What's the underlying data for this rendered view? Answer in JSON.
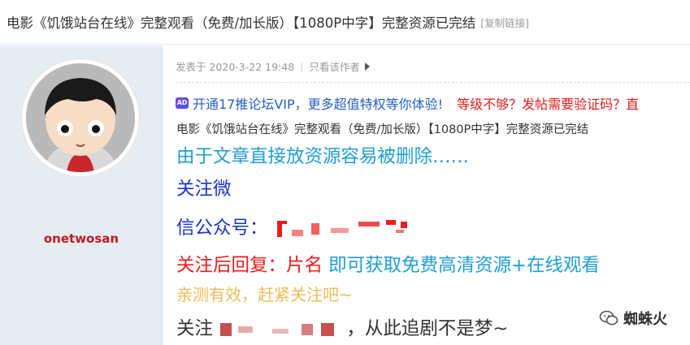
{
  "header": {
    "thread_title": "电影《饥饿站台在线》完整观看（免费/加长版）【1080P中字】完整资源已完结",
    "copy_link_label": "[复制链接]"
  },
  "sidebar": {
    "username": "onetwosan"
  },
  "post": {
    "posted_at": "发表于 2020-3-22 19:48",
    "separator": "|",
    "author_only_label": "只看该作者",
    "ad_badge": "AD",
    "promo_vip": "开通17推论坛VIP，更多超值特权等你体验!",
    "promo_help": "等级不够？发帖需要验证码？直",
    "description": "电影《饥饿站台在线》完整观看（免费/加长版）【1080P中字】完整资源已完结",
    "line1": "由于文章直接放资源容易被删除……",
    "line2": "关注微",
    "line3": "信公众号：",
    "line4_red": "关注后回复：片名 ",
    "line4_blue": "即可获取免费高清资源+在线观看",
    "line5": "亲测有效，赶紧关注吧~",
    "line6_start": "关注 ",
    "line6_end": "，从此追剧不是梦~"
  },
  "watermark": {
    "text": "蜘蛛火"
  },
  "colors": {
    "username": "#c7161d",
    "promo_vip": "#2560c4",
    "promo_help": "#e21a1a",
    "line1": "#1e9ed6",
    "line2_3": "#1a33c9",
    "line4_red": "#ee1b1b",
    "line4_blue": "#1e9ed6",
    "line5": "#eebc55",
    "sidebar_bg": "#e5edf2"
  },
  "icons": [
    "ad-icon",
    "arrow-right-icon",
    "wechat-icon"
  ]
}
